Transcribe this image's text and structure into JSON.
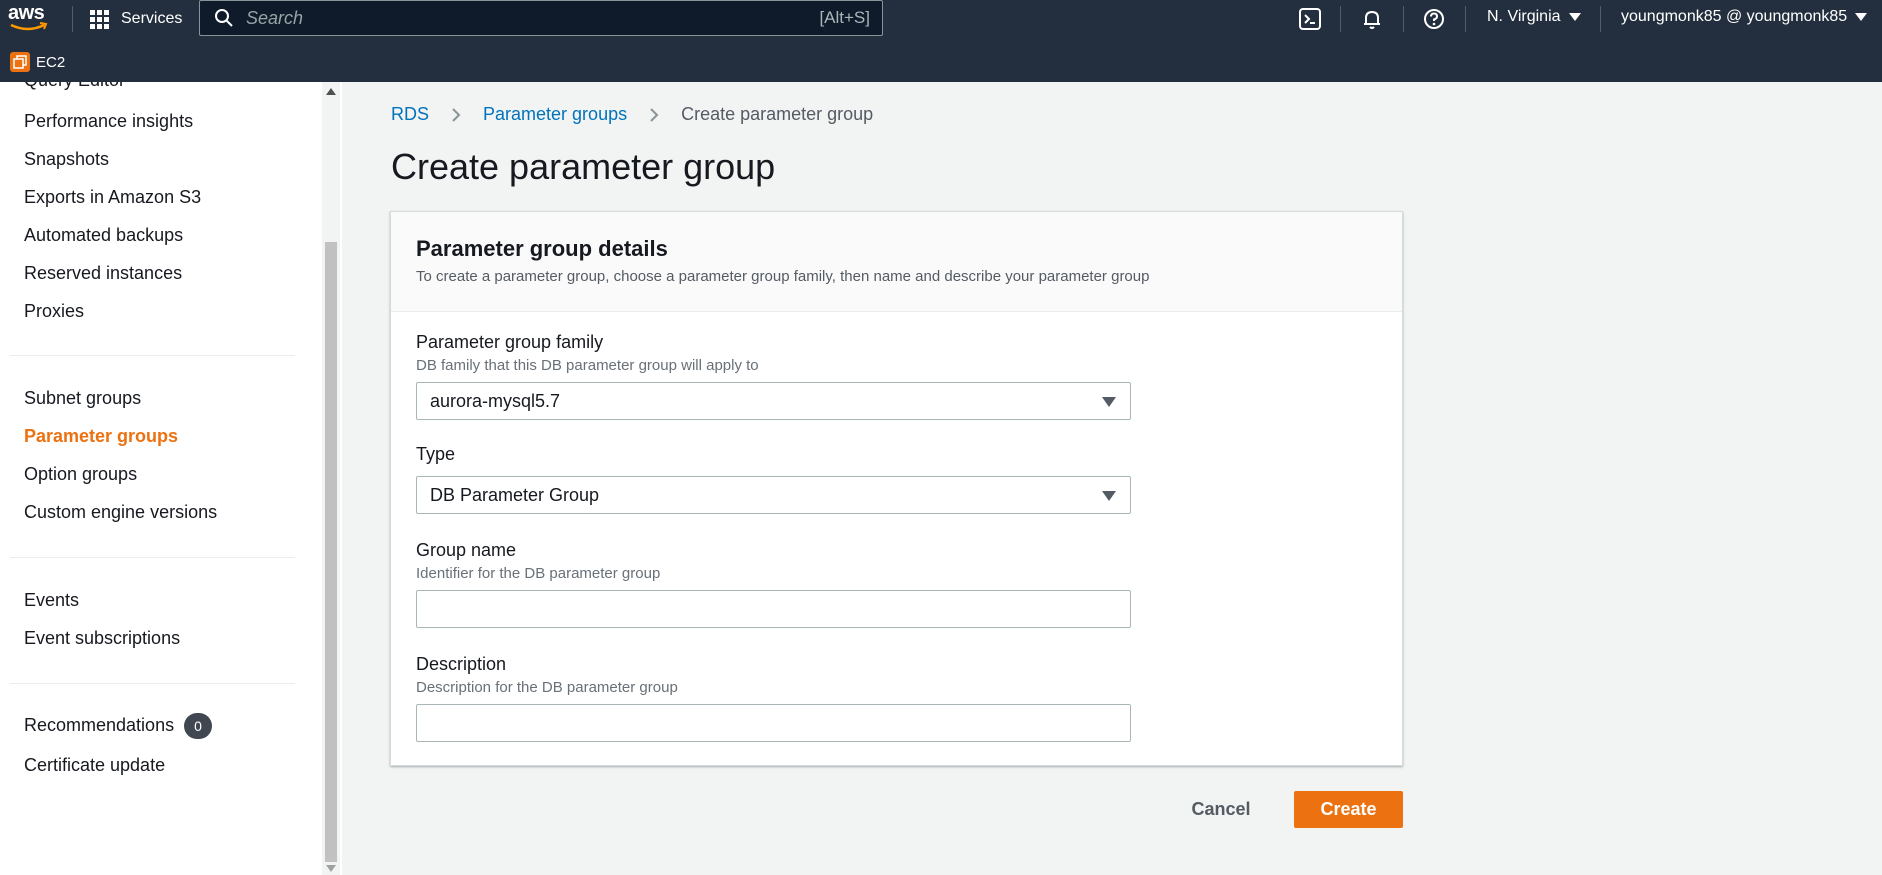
{
  "topnav": {
    "logo_text": "aws",
    "services_label": "Services",
    "search_placeholder": "Search",
    "search_shortcut": "[Alt+S]",
    "region": "N. Virginia",
    "user": "youngmonk85 @ youngmonk85",
    "service_badge": "EC2",
    "icons": [
      "cloudshell-icon",
      "bell-icon",
      "help-icon"
    ]
  },
  "sidebar": {
    "items_group1": [
      "Query Editor",
      "Performance insights",
      "Snapshots",
      "Exports in Amazon S3",
      "Automated backups",
      "Reserved instances",
      "Proxies"
    ],
    "items_group2": [
      "Subnet groups",
      "Parameter groups",
      "Option groups",
      "Custom engine versions"
    ],
    "items_group3": [
      "Events",
      "Event subscriptions"
    ],
    "recommendations": {
      "label": "Recommendations",
      "count": "0"
    },
    "certificate_update": "Certificate update",
    "active_item": "Parameter groups"
  },
  "breadcrumb": {
    "items": [
      "RDS",
      "Parameter groups"
    ],
    "current": "Create parameter group"
  },
  "page": {
    "title": "Create parameter group"
  },
  "panel": {
    "title": "Parameter group details",
    "description": "To create a parameter group, choose a parameter group family, then name and describe your parameter group",
    "family": {
      "label": "Parameter group family",
      "description": "DB family that this DB parameter group will apply to",
      "value": "aurora-mysql5.7"
    },
    "type": {
      "label": "Type",
      "value": "DB Parameter Group"
    },
    "group_name": {
      "label": "Group name",
      "description": "Identifier for the DB parameter group",
      "value": ""
    },
    "description_field": {
      "label": "Description",
      "description": "Description for the DB parameter group",
      "value": ""
    }
  },
  "actions": {
    "cancel": "Cancel",
    "create": "Create"
  },
  "colors": {
    "nav_bg": "#232f3e",
    "accent": "#ec7211",
    "link": "#0073bb"
  }
}
